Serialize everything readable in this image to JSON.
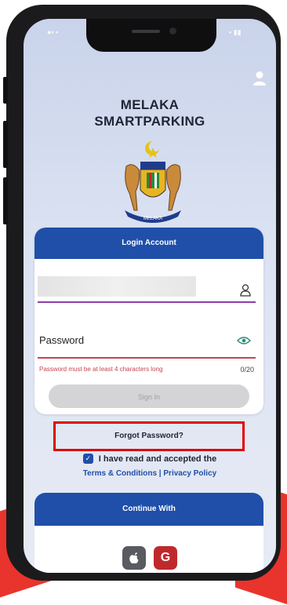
{
  "app": {
    "title_line1": "MELAKA",
    "title_line2": "SMARTPARKING",
    "crest_ribbon": "MELAKA"
  },
  "login_card": {
    "header": "Login Account",
    "username_value": "",
    "password_label": "Password",
    "password_error": "Password must be at least 4 characters long",
    "password_counter": "0/20",
    "signin_label": "Sign In"
  },
  "forgot_password_label": "Forgot Password?",
  "consent": {
    "checked": true,
    "text": "I have read and accepted the",
    "terms_link": "Terms & Conditions",
    "separator": " | ",
    "privacy_link": "Privacy Policy"
  },
  "continue_with": {
    "header": "Continue With",
    "providers": [
      "apple-icon",
      "google-icon"
    ],
    "google_glyph": "G"
  },
  "colors": {
    "primary": "#1f4fa8",
    "error": "#c8434f",
    "highlight_box": "#e00000",
    "focus_line": "#8e3ea8"
  }
}
